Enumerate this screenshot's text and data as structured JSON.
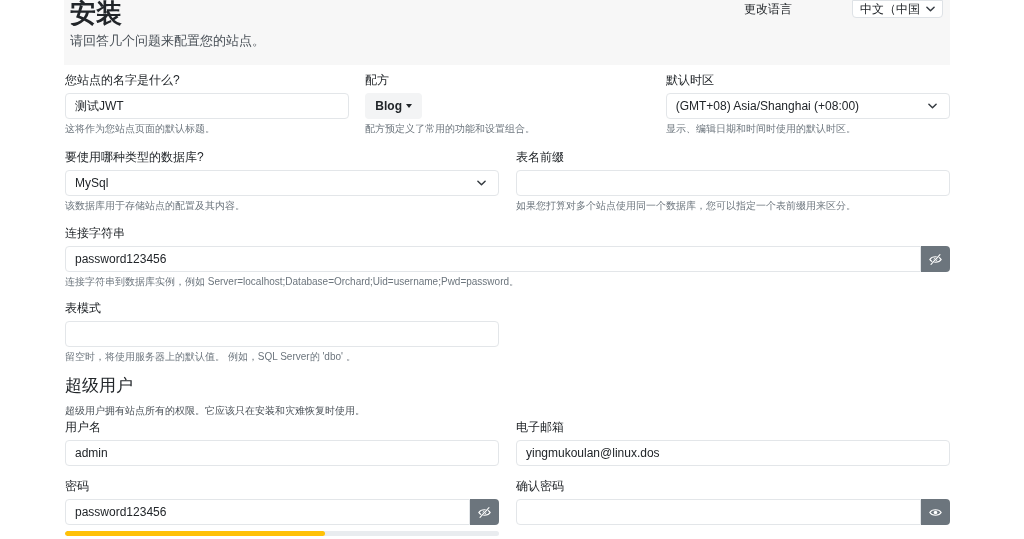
{
  "header": {
    "title": "安装",
    "subtitle": "请回答几个问题来配置您的站点。",
    "language": {
      "label": "更改语言",
      "value": "中文（中国"
    }
  },
  "site": {
    "site_name": {
      "label": "您站点的名字是什么?",
      "value": "测试JWT",
      "hint": "这将作为您站点页面的默认标题。"
    },
    "recipe": {
      "label": "配方",
      "value": "Blog",
      "hint": "配方预定义了常用的功能和设置组合。"
    },
    "timezone": {
      "label": "默认时区",
      "value": "(GMT+08) Asia/Shanghai (+08:00)",
      "hint": "显示、编辑日期和时间时使用的默认时区。"
    },
    "database": {
      "label": "要使用哪种类型的数据库?",
      "value": "MySql",
      "hint": "该数据库用于存储站点的配置及其内容。"
    },
    "table_prefix": {
      "label": "表名前缀",
      "hint": "如果您打算对多个站点使用同一个数据库，您可以指定一个表前缀用来区分。"
    },
    "connection_string": {
      "label": "连接字符串",
      "value": "password123456",
      "revealed": true,
      "hint": "连接字符串到数据库实例，例如 Server=localhost;Database=Orchard;Uid=username;Pwd=password。"
    },
    "table_schema": {
      "label": "表模式",
      "hint": "留空时，将使用服务器上的默认值。 例如，SQL Server的 'dbo' 。"
    }
  },
  "superuser": {
    "title": "超级用户",
    "description": "超级用户拥有站点所有的权限。它应该只在安装和灾难恢复时使用。",
    "username": {
      "label": "用户名",
      "value": "admin"
    },
    "email": {
      "label": "电子邮箱",
      "value": "yingmukoulan@linux.dos"
    },
    "password": {
      "label": "密码",
      "value": "password123456",
      "revealed": true,
      "level": 0.6
    },
    "confirm_password": {
      "label": "确认密码",
      "revealed": false
    }
  }
}
